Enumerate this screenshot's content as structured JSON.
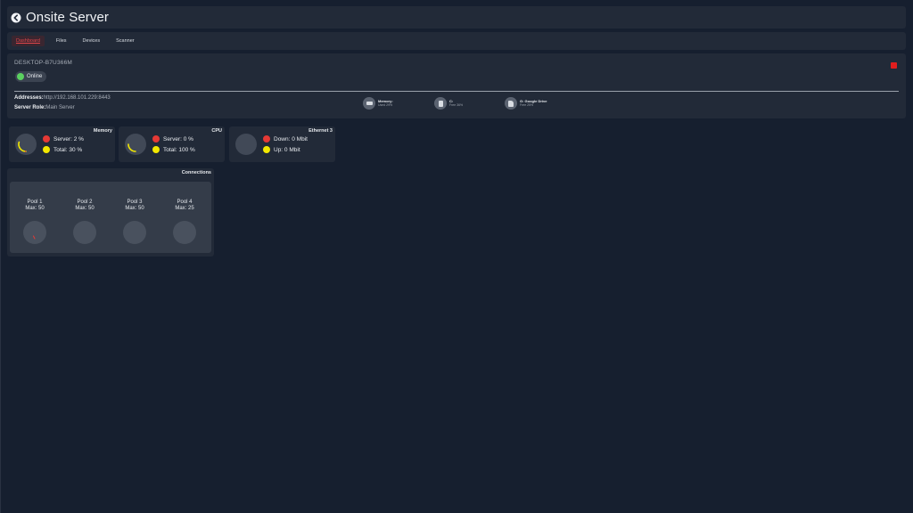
{
  "header": {
    "title": "Onsite Server",
    "back_icon": "back-arrow-icon"
  },
  "tabs": [
    {
      "label": "Dashboard",
      "active": true
    },
    {
      "label": "Files",
      "active": false
    },
    {
      "label": "Devices",
      "active": false
    },
    {
      "label": "Scanner",
      "active": false
    }
  ],
  "device": {
    "name": "DESKTOP-B7U366M",
    "status": "Online",
    "addresses_label": "Addresses:",
    "addresses_value": "http://192.168.101.229:8443",
    "role_label": "Server Role:",
    "role_value": "Main Server",
    "stats": [
      {
        "icon": "memory-icon",
        "label": "Memory:",
        "sub": "Used 29%"
      },
      {
        "icon": "drive-icon",
        "label": "C:",
        "sub": "Free 36%"
      },
      {
        "icon": "cloud-drive-icon",
        "label": "G: Google Drive",
        "sub": "Free 25%"
      }
    ]
  },
  "metrics": {
    "memory": {
      "title": "Memory",
      "server": "Server: 2 %",
      "total": "Total: 30 %",
      "server_pct": 2,
      "total_pct": 30
    },
    "cpu": {
      "title": "CPU",
      "server": "Server: 0 %",
      "total": "Total: 100 %",
      "server_pct": 0,
      "total_pct": 100
    },
    "network": {
      "title": "Ethernet 3",
      "down": "Down: 0 Mbit",
      "up": "Up: 0 Mbit"
    }
  },
  "connections": {
    "title": "Connections",
    "pools": [
      {
        "name": "Pool 1",
        "max": "Max: 50"
      },
      {
        "name": "Pool 2",
        "max": "Max: 50"
      },
      {
        "name": "Pool 3",
        "max": "Max: 50"
      },
      {
        "name": "Pool 4",
        "max": "Max: 25"
      }
    ]
  },
  "colors": {
    "background": "#161f2f",
    "panel": "#222a38",
    "accent_red": "#e0464b",
    "server_dot": "#e53935",
    "total_dot": "#f3e800",
    "online": "#5bd160"
  }
}
